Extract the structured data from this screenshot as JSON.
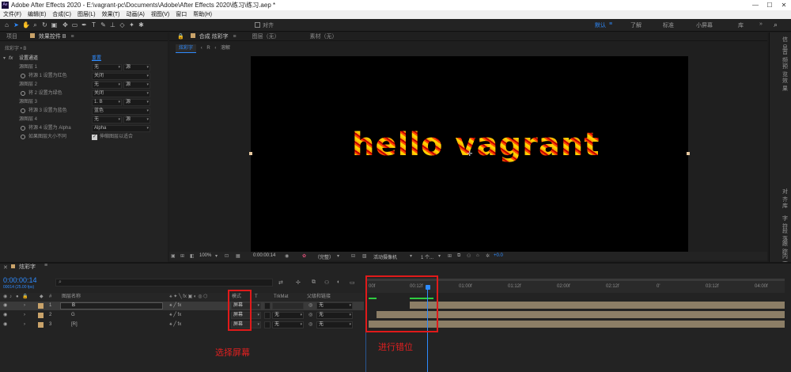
{
  "window": {
    "title": "Adobe After Effects 2020 - E:\\vagrant-pc\\Documents\\Adobe\\After Effects 2020\\练习\\练习.aep *",
    "logo": "Ae",
    "controls": [
      "—",
      "☐",
      "✕"
    ]
  },
  "menu": [
    "文件(F)",
    "编辑(E)",
    "合成(C)",
    "图层(L)",
    "效果(T)",
    "动画(A)",
    "视图(V)",
    "窗口",
    "帮助(H)"
  ],
  "toolbar": {
    "align_label": "对齐",
    "workspaces": [
      "默认",
      "了解",
      "标准",
      "小屏幕",
      "库"
    ]
  },
  "panels": {
    "project_tab": "项目",
    "effects_tab": "效果控件 B",
    "comp_tab": "合成 炫彩字",
    "layer_tab": "图层（无）",
    "footage_tab": "素材（无）"
  },
  "effects": {
    "breadcrumb": "炫彩字 • B",
    "effect_name": "设置通道",
    "reset_label": "重置",
    "rows": [
      {
        "label": "源图层 1",
        "value": "无",
        "value2": "源"
      },
      {
        "label": "将源 1 设置为红色",
        "value": "关闭"
      },
      {
        "label": "源图层 2",
        "value": "无",
        "value2": "源"
      },
      {
        "label": "将 2 设置为绿色",
        "value": "关闭"
      },
      {
        "label": "源图层 3",
        "value": "1. B",
        "value2": "源"
      },
      {
        "label": "将源 3 设置为蓝色",
        "value": "蓝色"
      },
      {
        "label": "源图层 4",
        "value": "无",
        "value2": "源"
      },
      {
        "label": "将源 4 设置为 Alpha",
        "value": "Alpha"
      },
      {
        "label": "如果图层大小不同",
        "checkbox_label": "伸缩图层以适合"
      }
    ]
  },
  "viewer": {
    "breadcrumb_tab": "炫彩字",
    "breadcrumb_extra": [
      "R",
      "溶解"
    ],
    "canvas_text": "hello vagrant",
    "zoom": "100%",
    "timecode": "0:00:00:14",
    "quality": "（完整）",
    "camera": "活动摄像机",
    "views": "1 个...",
    "exposure": "+0.0"
  },
  "right_panel": [
    "信息",
    "音频",
    "预览",
    "效果",
    "对齐",
    "库",
    "字符",
    "段落",
    "跟踪",
    "内容"
  ],
  "timeline": {
    "comp_name": "炫彩字",
    "timecode": "0:00:00:14",
    "fps_info": "00014 (25.00 fps)",
    "search_placeholder": "",
    "col_layer_name": "图层名称",
    "col_mode": "模式",
    "col_trkmat": "TrkMat",
    "col_parent": "父级和链接",
    "ruler": [
      "00f",
      "00:12f",
      "01:00f",
      "01:12f",
      "02:00f",
      "02:12f",
      "0'",
      "03:12f",
      "04:00f"
    ],
    "layers": [
      {
        "num": "1",
        "name": "B",
        "mode": "屏幕",
        "trkmat": "",
        "parent": "无"
      },
      {
        "num": "2",
        "name": "G",
        "mode": "屏幕",
        "trkmat": "无",
        "parent": "无"
      },
      {
        "num": "3",
        "name": "[R]",
        "mode": "屏幕",
        "trkmat": "无",
        "parent": "无"
      }
    ]
  },
  "annotations": {
    "mode_note": "选择屏幕",
    "offset_note": "进行错位"
  },
  "colors": {
    "annotation_red": "#e01a1a",
    "accent_blue": "#2e8bff",
    "track_tan": "#8c7e66"
  }
}
